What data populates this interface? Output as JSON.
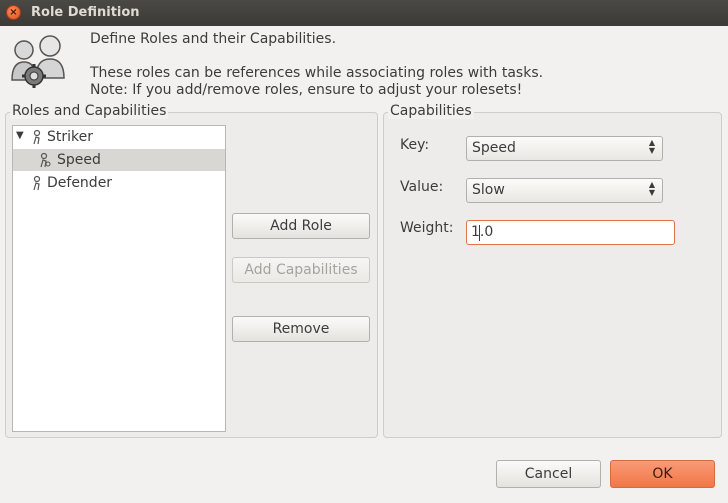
{
  "window": {
    "title": "Role Definition"
  },
  "intro": {
    "line1": "Define Roles and their Capabilities.",
    "line2": "These roles can be references while associating roles with tasks.",
    "line3": "Note: If you add/remove roles, ensure to adjust your rolesets!"
  },
  "roles_frame": {
    "label": "Roles and Capabilities",
    "tree": [
      {
        "label": "Striker",
        "level": 0,
        "expanded": true,
        "selected": false
      },
      {
        "label": "Speed",
        "level": 1,
        "expanded": false,
        "selected": true
      },
      {
        "label": "Defender",
        "level": 0,
        "expanded": false,
        "selected": false
      }
    ]
  },
  "actions": {
    "add_role": "Add Role",
    "add_capabilities": "Add Capabilities",
    "remove": "Remove"
  },
  "capabilities_frame": {
    "label": "Capabilities",
    "key_label": "Key:",
    "key_value": "Speed",
    "value_label": "Value:",
    "value_value": "Slow",
    "weight_label": "Weight:",
    "weight_value": "1.0"
  },
  "footer": {
    "cancel": "Cancel",
    "ok": "OK"
  },
  "colors": {
    "accent": "#f07746",
    "titlebar": "#3c3b37",
    "selection": "#d8d7d4"
  },
  "icons": [
    "close-icon",
    "roles-settings-icon",
    "role-icon",
    "capability-icon",
    "tree-expander-icon",
    "combo-arrows-icon"
  ]
}
